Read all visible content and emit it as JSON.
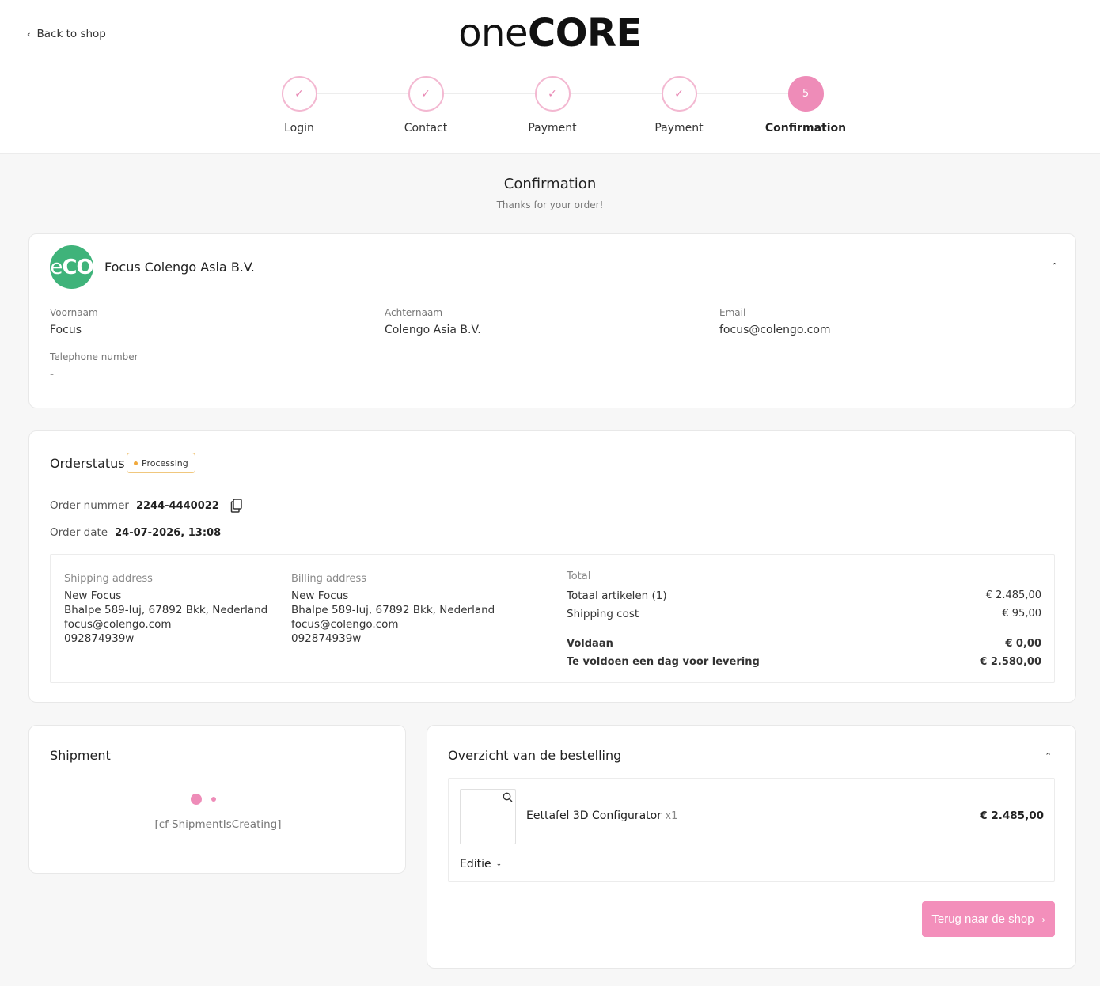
{
  "header": {
    "back_label": "Back to shop",
    "logo_light": "one",
    "logo_bold": "CORE"
  },
  "steps": [
    {
      "label": "Login",
      "marker": "✓"
    },
    {
      "label": "Contact",
      "marker": "✓"
    },
    {
      "label": "Payment",
      "marker": "✓"
    },
    {
      "label": "Payment",
      "marker": "✓"
    },
    {
      "label": "Confirmation",
      "marker": "5"
    }
  ],
  "page": {
    "title": "Confirmation",
    "subtitle": "Thanks for your order!"
  },
  "customer": {
    "avatar_e": "e",
    "avatar_co": "CO",
    "name": "Focus Colengo Asia B.V.",
    "fields": {
      "first_name_label": "Voornaam",
      "first_name": "Focus",
      "last_name_label": "Achternaam",
      "last_name": "Colengo Asia B.V.",
      "email_label": "Email",
      "email": "focus@colengo.com",
      "phone_label": "Telephone number",
      "phone": "-"
    }
  },
  "order": {
    "title": "Orderstatus",
    "status": "Processing",
    "number_label": "Order nummer",
    "number": "2244-4440022",
    "date_label": "Order date",
    "date": "24-07-2026, 13:08",
    "shipping": {
      "label": "Shipping address",
      "name": "New Focus",
      "street": "Bhalpe 589-Iuj, 67892 Bkk, Nederland",
      "email": "focus@colengo.com",
      "phone": "092874939w"
    },
    "billing": {
      "label": "Billing address",
      "name": "New Focus",
      "street": "Bhalpe 589-Iuj, 67892 Bkk, Nederland",
      "email": "focus@colengo.com",
      "phone": "092874939w"
    },
    "totals": {
      "label": "Total",
      "items_label": "Totaal artikelen (1)",
      "items_value": "€ 2.485,00",
      "shipping_label": "Shipping cost",
      "shipping_value": "€ 95,00",
      "paid_label": "Voldaan",
      "paid_value": "€ 0,00",
      "due_label": "Te voldoen een dag voor levering",
      "due_value": "€ 2.580,00"
    }
  },
  "shipment": {
    "title": "Shipment",
    "status_text": "[cf-ShipmentIsCreating]"
  },
  "overview": {
    "title": "Overzicht van de bestelling",
    "product_name": "Eettafel 3D Configurator",
    "product_qty": "x1",
    "product_price": "€ 2.485,00",
    "editie_label": "Editie",
    "back_button": "Terug naar de shop"
  },
  "colors": {
    "accent": "#ee8cb8",
    "button": "#f38fbb",
    "avatar_bg": "#3fb37a",
    "status_border": "#f0c77d"
  },
  "icons": {
    "back": "chevron-left-icon",
    "step_done": "check-icon",
    "collapse": "chevron-up-icon",
    "copy": "copy-icon",
    "zoom": "search-icon",
    "dropdown": "chevron-down-icon",
    "button": "chevron-right-icon"
  }
}
